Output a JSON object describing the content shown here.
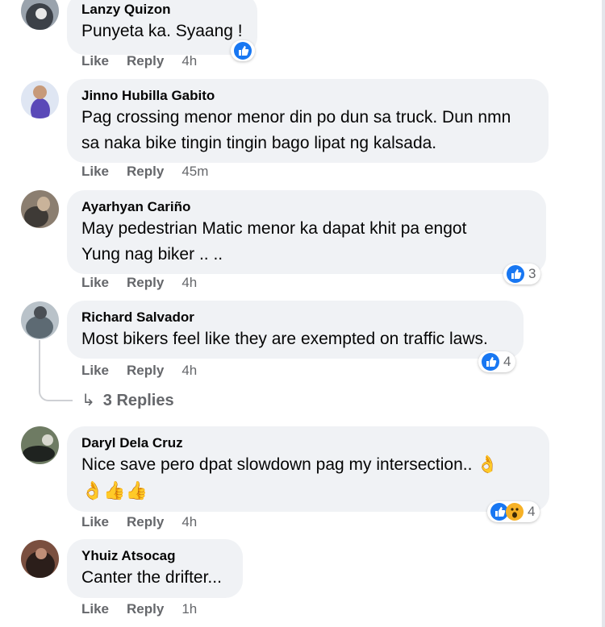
{
  "colors": {
    "bubble": "#f0f2f5",
    "like_blue": "#1877f2",
    "wow_yellow": "#f7b125",
    "meta_gray": "#65676b"
  },
  "actions": {
    "like": "Like",
    "reply": "Reply"
  },
  "comments": [
    {
      "author": "Lanzy Quizon",
      "lines": [
        "Punyeta ka. Syaang !"
      ],
      "time": "4h",
      "reactions": {
        "icons": [
          "like-icon"
        ],
        "count": ""
      }
    },
    {
      "author": "Jinno Hubilla Gabito",
      "lines": [
        "Pag crossing menor menor din po dun sa truck. Dun nmn",
        "sa naka bike tingin tingin bago lipat ng kalsada."
      ],
      "time": "45m",
      "reactions": null
    },
    {
      "author": "Ayarhyan Cariño",
      "lines": [
        "May pedestrian Matic menor ka dapat khit pa engot",
        "Yung nag biker .. .."
      ],
      "time": "4h",
      "reactions": {
        "icons": [
          "like-icon"
        ],
        "count": "3"
      }
    },
    {
      "author": "Richard Salvador",
      "lines": [
        "Most bikers feel like they are exempted on traffic laws."
      ],
      "time": "4h",
      "reactions": {
        "icons": [
          "like-icon"
        ],
        "count": "4"
      },
      "replies_label": "3 Replies"
    },
    {
      "author": "Daryl Dela Cruz",
      "lines": [
        "Nice save pero dpat slowdown pag my intersection.. 👌",
        "👌👍👍"
      ],
      "time": "4h",
      "reactions": {
        "icons": [
          "like-icon",
          "wow-icon"
        ],
        "count": "4"
      }
    },
    {
      "author": "Yhuiz Atsocag",
      "lines": [
        "Canter the drifter..."
      ],
      "time": "1h",
      "reactions": null
    }
  ]
}
